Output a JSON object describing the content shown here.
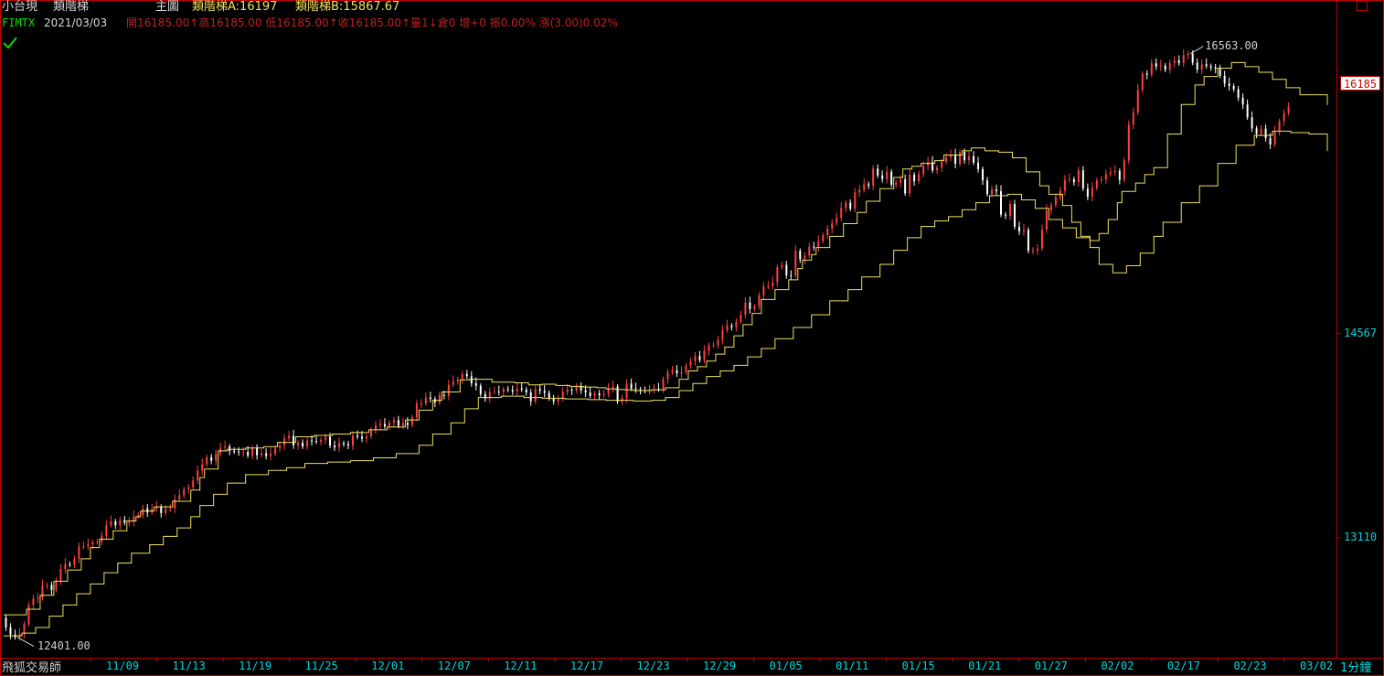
{
  "header": {
    "symbol_name": "小台現",
    "indicator_name": "類階梯",
    "chart_label": "主圖",
    "ladder_a": "類階梯A:16197",
    "ladder_b": "類階梯B:15867.67",
    "ticker": "FIMTX",
    "date": "2021/03/03",
    "quote": "開16185.00↑高16185.00 低16185.00↑收16185.00↑量1↓倉0 增+0 振0.00% 漲(3.00)0.02%"
  },
  "footer": {
    "brand": "飛狐交易師",
    "interval": "1分鐘"
  },
  "colors": {
    "background": "#000000",
    "axis": "#c00000",
    "ladder": "#f0e060",
    "label": "#00d8e0",
    "up_candle": "#ff4040",
    "down_candle": "#ffffff"
  },
  "icons": {
    "checkmark": "check-icon",
    "window": "window-restore-icon"
  },
  "chart_data": {
    "type": "line",
    "title": "",
    "xlabel": "",
    "ylabel": "",
    "y_ticks": [
      14567,
      13110
    ],
    "ylim": [
      12300,
      16750
    ],
    "x_ticks": [
      "11/09",
      "11/13",
      "11/19",
      "11/25",
      "12/01",
      "12/07",
      "12/11",
      "12/17",
      "12/23",
      "12/29",
      "01/05",
      "01/11",
      "01/15",
      "01/21",
      "01/27",
      "02/02",
      "02/17",
      "02/23",
      "03/02"
    ],
    "last_price": "16185",
    "high_label": "16563.00",
    "low_label": "12401.00",
    "price_path": {
      "x": [
        0,
        5,
        10,
        15,
        20,
        25,
        30,
        35,
        40,
        45,
        50,
        55,
        60,
        65,
        70,
        75,
        80,
        85,
        90,
        95,
        100,
        105,
        110,
        115,
        120,
        125,
        130,
        135,
        140,
        145,
        150,
        155,
        160,
        165,
        170,
        175,
        180,
        185,
        190,
        195,
        200,
        205,
        210,
        215,
        220,
        225,
        230,
        235,
        240,
        245,
        250,
        255,
        260,
        265,
        270,
        275,
        280,
        285,
        290,
        295,
        300,
        305,
        310,
        315,
        320,
        325,
        330,
        335,
        340,
        345,
        350,
        355,
        360,
        365,
        370,
        375,
        380,
        385,
        390,
        395,
        400,
        405,
        410,
        415,
        420,
        425,
        430,
        435,
        440,
        445,
        450,
        455,
        460,
        465,
        470,
        475,
        480,
        485,
        490,
        495,
        500,
        505,
        510,
        515,
        520,
        525,
        530,
        535,
        540,
        545,
        550,
        555,
        560,
        565,
        570,
        575,
        580,
        585,
        590,
        595,
        600,
        605,
        610,
        615,
        620,
        625,
        630,
        635,
        640,
        645,
        650,
        655,
        660,
        665,
        670,
        675,
        680,
        685,
        690,
        695,
        700,
        705,
        710,
        715,
        720,
        725,
        730,
        735,
        740,
        745,
        750,
        755,
        760,
        765,
        770,
        775,
        780,
        785,
        790,
        795,
        800,
        805,
        810,
        815,
        820,
        825,
        830,
        835,
        840,
        845,
        850,
        855,
        860,
        865,
        870,
        875,
        880,
        885,
        890,
        895,
        900,
        905,
        910,
        915,
        920,
        925,
        930,
        935,
        940,
        945,
        950,
        955,
        960,
        965,
        970,
        975,
        980,
        985,
        990,
        995,
        1000,
        1005,
        1010,
        1015,
        1020,
        1025,
        1030,
        1035,
        1040,
        1045,
        1050,
        1055,
        1060,
        1065,
        1070,
        1075,
        1080,
        1085,
        1090,
        1095,
        1100,
        1105,
        1110,
        1115,
        1120,
        1125,
        1130,
        1135,
        1140,
        1145,
        1150,
        1155,
        1160,
        1165,
        1170,
        1175,
        1180,
        1185,
        1190,
        1195,
        1200,
        1205,
        1210,
        1215,
        1220,
        1225,
        1230,
        1235,
        1240,
        1245,
        1250,
        1255,
        1260,
        1265,
        1270,
        1275,
        1280,
        1285,
        1290,
        1295,
        1300,
        1305,
        1310,
        1315,
        1320,
        1325,
        1330,
        1335,
        1340,
        1345,
        1350,
        1355,
        1360,
        1365,
        1370,
        1375,
        1380,
        1385,
        1390,
        1395,
        1400,
        1405,
        1410,
        1415,
        1420,
        1425,
        1430,
        1435,
        1440,
        1445,
        1450
      ],
      "y": [
        12540,
        12470,
        12419,
        12401,
        12424,
        12495,
        12629,
        12676,
        12680,
        12768,
        12773,
        12737,
        12796,
        12887,
        12923,
        12917,
        12958,
        13046,
        13048,
        13062,
        13078,
        13081,
        13125,
        13199,
        13227,
        13199,
        13236,
        13217,
        13222,
        13263,
        13273,
        13320,
        13291,
        13317,
        13331,
        13286,
        13318,
        13318,
        13384,
        13413,
        13456,
        13470,
        13519,
        13588,
        13633,
        13684,
        13659,
        13708,
        13753,
        13761,
        13730,
        13726,
        13720,
        13722,
        13696,
        13753,
        13699,
        13712,
        13693,
        13709,
        13750,
        13768,
        13819,
        13837,
        13769,
        13788,
        13761,
        13803,
        13800,
        13795,
        13809,
        13829,
        13767,
        13754,
        13784,
        13777,
        13767,
        13839,
        13830,
        13817,
        13833,
        13876,
        13912,
        13921,
        13904,
        13931,
        13949,
        13908,
        13929,
        13915,
        13969,
        14068,
        14069,
        14110,
        14100,
        14074,
        14129,
        14122,
        14201,
        14226,
        14239,
        14278,
        14262,
        14212,
        14193,
        14134,
        14103,
        14151,
        14153,
        14148,
        14170,
        14166,
        14154,
        14175,
        14167,
        14147,
        14083,
        14171,
        14157,
        14144,
        14105,
        14084,
        14100,
        14151,
        14166,
        14160,
        14189,
        14161,
        14146,
        14121,
        14140,
        14126,
        14136,
        14176,
        14188,
        14082,
        14106,
        14209,
        14174,
        14168,
        14165,
        14158,
        14170,
        14172,
        14169,
        14242,
        14290,
        14305,
        14282,
        14290,
        14340,
        14370,
        14406,
        14378,
        14441,
        14484,
        14484,
        14522,
        14590,
        14623,
        14613,
        14651,
        14700,
        14788,
        14741,
        14761,
        14839,
        14902,
        14905,
        14933,
        15040,
        15056,
        14982,
        14980,
        15156,
        15095,
        15124,
        15186,
        15183,
        15226,
        15269,
        15315,
        15353,
        15392,
        15462,
        15500,
        15457,
        15574,
        15591,
        15632,
        15622,
        15743,
        15694,
        15669,
        15721,
        15628,
        15642,
        15666,
        15566,
        15700,
        15653,
        15705,
        15764,
        15790,
        15730,
        15751,
        15791,
        15823,
        15843,
        15777,
        15862,
        15803,
        15832,
        15786,
        15739,
        15659,
        15561,
        15593,
        15582,
        15415,
        15407,
        15491,
        15328,
        15295,
        15306,
        15157,
        15159,
        15173,
        15308,
        15446,
        15484,
        15540,
        15585,
        15662,
        15667,
        15646,
        15731,
        15601,
        15542,
        15605,
        15660,
        15667,
        15704,
        15717,
        15727,
        15663,
        15801,
        16057,
        16144,
        16304,
        16421,
        16413,
        16494,
        16471,
        16477,
        16448,
        16496,
        16515,
        16496,
        16552,
        16563,
        16499,
        16450,
        16486,
        16474,
        16465,
        16455,
        16405,
        16351,
        16332,
        16309,
        16249,
        16200,
        16109,
        16030,
        15991,
        16028,
        15961,
        15915,
        16005,
        16081,
        16140,
        16185
      ]
    },
    "series": [
      {
        "name": "類階梯A",
        "x": [
          0,
          10,
          25,
          40,
          55,
          70,
          85,
          95,
          105,
          120,
          135,
          145,
          150,
          165,
          185,
          205,
          215,
          220,
          235,
          245,
          265,
          285,
          300,
          320,
          340,
          360,
          380,
          400,
          420,
          440,
          455,
          470,
          480,
          500,
          510,
          535,
          560,
          575,
          590,
          605,
          620,
          635,
          650,
          660,
          670,
          680,
          690,
          700,
          710,
          725,
          740,
          750,
          760,
          770,
          780,
          790,
          800,
          810,
          820,
          830,
          845,
          860,
          870,
          875,
          885,
          890,
          905,
          920,
          935,
          945,
          960,
          975,
          985,
          995,
          1005,
          1020,
          1030,
          1050,
          1060,
          1075,
          1090,
          1105,
          1120,
          1135,
          1145,
          1160,
          1170,
          1180,
          1190,
          1200,
          1210,
          1220,
          1225,
          1240,
          1250,
          1260,
          1275,
          1290,
          1305,
          1315,
          1330,
          1345,
          1360,
          1375,
          1390,
          1405,
          1420,
          1450
        ],
        "y": [
          12560,
          12560,
          12600,
          12700,
          12800,
          12880,
          12960,
          13040,
          13100,
          13160,
          13230,
          13260,
          13300,
          13330,
          13370,
          13450,
          13540,
          13600,
          13730,
          13740,
          13750,
          13760,
          13790,
          13830,
          13840,
          13850,
          13860,
          13880,
          13900,
          13950,
          14020,
          14090,
          14150,
          14236,
          14240,
          14220,
          14215,
          14200,
          14205,
          14196,
          14190,
          14185,
          14180,
          14172,
          14168,
          14165,
          14160,
          14160,
          14165,
          14180,
          14240,
          14300,
          14330,
          14370,
          14420,
          14470,
          14550,
          14630,
          14710,
          14810,
          14880,
          14950,
          15030,
          15090,
          15130,
          15180,
          15260,
          15350,
          15430,
          15510,
          15600,
          15680,
          15740,
          15760,
          15780,
          15800,
          15840,
          15870,
          15890,
          15870,
          15860,
          15820,
          15720,
          15620,
          15560,
          15480,
          15360,
          15260,
          15230,
          15280,
          15380,
          15500,
          15580,
          15640,
          15700,
          15750,
          15990,
          16200,
          16340,
          16400,
          16460,
          16500,
          16470,
          16430,
          16380,
          16320,
          16270,
          16197
        ]
      },
      {
        "name": "類階梯B",
        "x": [
          0,
          20,
          35,
          50,
          65,
          80,
          95,
          110,
          125,
          140,
          160,
          175,
          190,
          205,
          215,
          230,
          245,
          265,
          290,
          310,
          330,
          355,
          380,
          405,
          430,
          455,
          470,
          490,
          505,
          520,
          545,
          570,
          590,
          615,
          640,
          660,
          690,
          710,
          725,
          740,
          755,
          770,
          785,
          800,
          815,
          830,
          845,
          865,
          885,
          905,
          925,
          940,
          960,
          975,
          990,
          1005,
          1020,
          1035,
          1050,
          1065,
          1080,
          1100,
          1115,
          1130,
          1145,
          1160,
          1175,
          1190,
          1200,
          1215,
          1230,
          1245,
          1260,
          1270,
          1290,
          1310,
          1330,
          1350,
          1370,
          1390,
          1410,
          1430,
          1450
        ],
        "y": [
          12410,
          12430,
          12470,
          12550,
          12630,
          12710,
          12780,
          12860,
          12930,
          13000,
          13060,
          13120,
          13180,
          13260,
          13340,
          13420,
          13500,
          13560,
          13590,
          13610,
          13640,
          13650,
          13660,
          13680,
          13710,
          13770,
          13850,
          13930,
          14030,
          14110,
          14120,
          14110,
          14105,
          14100,
          14095,
          14090,
          14085,
          14090,
          14110,
          14160,
          14210,
          14260,
          14300,
          14340,
          14400,
          14460,
          14530,
          14610,
          14700,
          14800,
          14880,
          14970,
          15060,
          15160,
          15250,
          15330,
          15370,
          15400,
          15450,
          15500,
          15550,
          15560,
          15520,
          15460,
          15380,
          15320,
          15250,
          15180,
          15060,
          15000,
          15050,
          15140,
          15260,
          15360,
          15500,
          15620,
          15780,
          15910,
          15980,
          16010,
          16000,
          15990,
          15868
        ]
      }
    ]
  }
}
